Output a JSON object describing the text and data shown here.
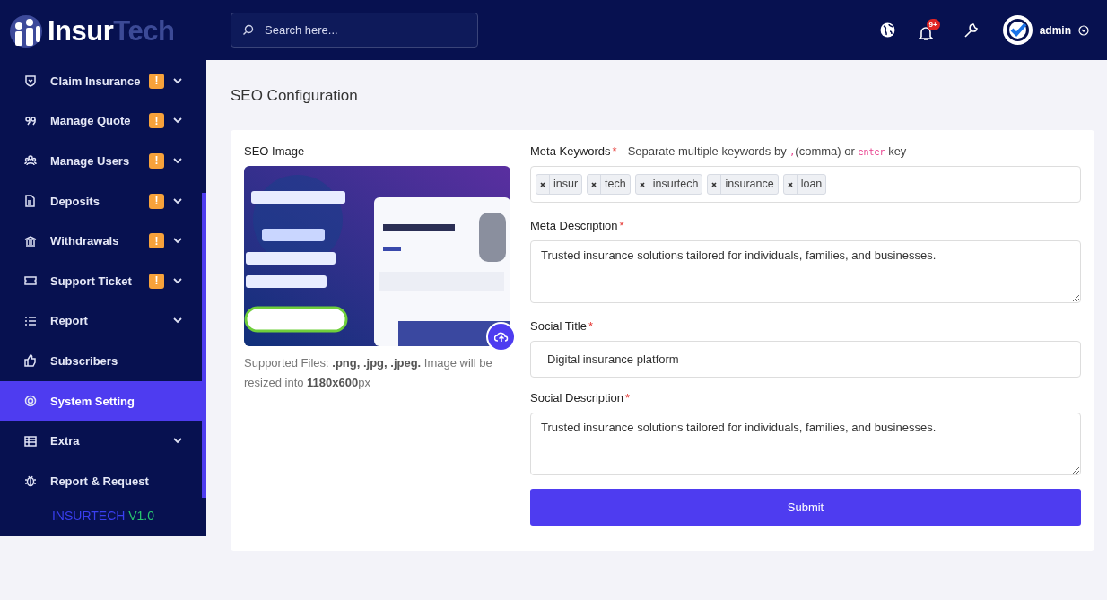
{
  "brand": {
    "part1": "Insur",
    "part2": "Tech"
  },
  "sidebar": {
    "items": [
      {
        "label": "Claim Insurance",
        "badge": "!",
        "has_submenu": true,
        "selected": false
      },
      {
        "label": "Manage Quote",
        "badge": "!",
        "has_submenu": true,
        "selected": false
      },
      {
        "label": "Manage Users",
        "badge": "!",
        "has_submenu": true,
        "selected": false
      },
      {
        "label": "Deposits",
        "badge": "!",
        "has_submenu": true,
        "selected": false
      },
      {
        "label": "Withdrawals",
        "badge": "!",
        "has_submenu": true,
        "selected": false
      },
      {
        "label": "Support Ticket",
        "badge": "!",
        "has_submenu": true,
        "selected": false
      },
      {
        "label": "Report",
        "has_submenu": true,
        "selected": false
      },
      {
        "label": "Subscribers",
        "has_submenu": false,
        "selected": false
      },
      {
        "label": "System Setting",
        "has_submenu": false,
        "selected": true
      },
      {
        "label": "Extra",
        "has_submenu": true,
        "selected": false
      },
      {
        "label": "Report & Request",
        "has_submenu": false,
        "selected": false
      }
    ],
    "version": {
      "name": "INSURTECH",
      "number": "V1.0"
    }
  },
  "topbar": {
    "search": {
      "placeholder": "Search here..."
    },
    "notification_count": "9+",
    "user": "admin"
  },
  "page_title": "SEO Configuration",
  "seo_image": {
    "label": "SEO Image",
    "note": "Supported Files: **.png, .jpg, .jpeg.** Image will be resized into **1180x600**px"
  },
  "meta_keywords": {
    "label": "Meta Keywords",
    "required_mark": "*",
    "hint": {
      "before": "Separate multiple keywords by",
      "comma": ",",
      "middle": "(comma) or",
      "key": "enter",
      "after": "key"
    },
    "tags": [
      "insur",
      "tech",
      "insurtech",
      "insurance",
      "loan"
    ]
  },
  "meta_description": {
    "label": "Meta Description",
    "required_mark": "*",
    "value": "Trusted insurance solutions tailored for individuals, families, and businesses."
  },
  "social_title": {
    "label": "Social Title",
    "required_mark": "*",
    "value": "Digital insurance platform"
  },
  "social_description": {
    "label": "Social Description",
    "required_mark": "*",
    "value": "Trusted insurance solutions tailored for individuals, families, and businesses."
  },
  "submit": "Submit"
}
